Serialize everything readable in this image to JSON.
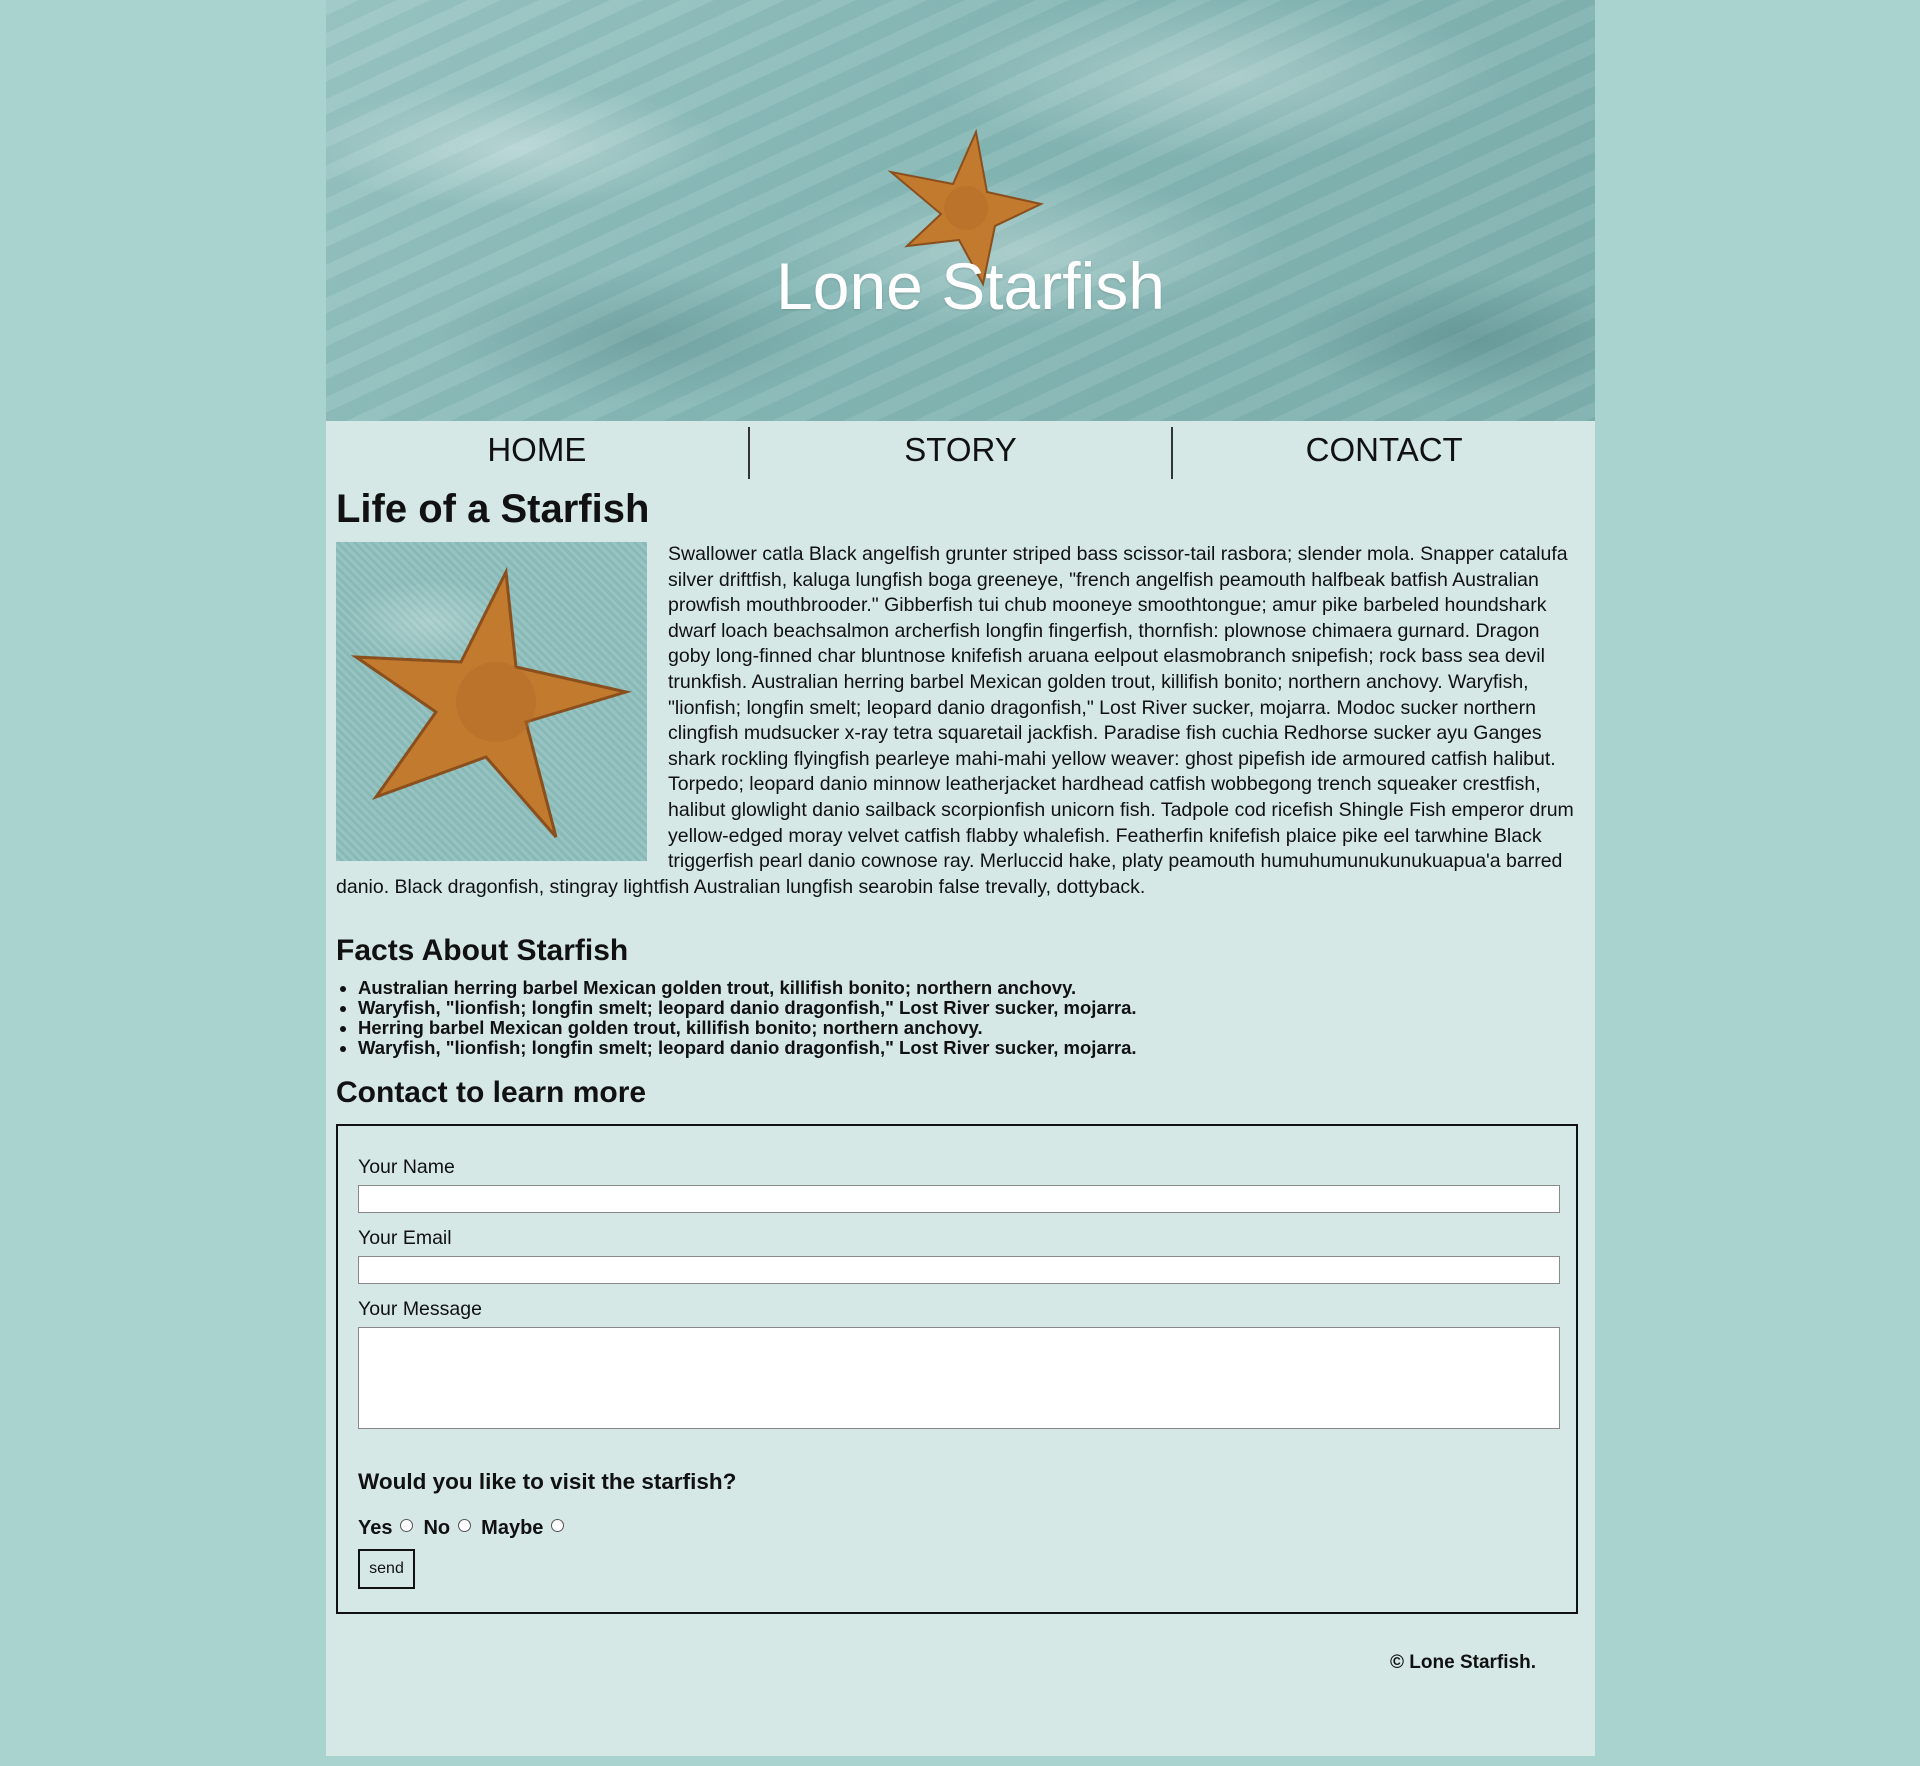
{
  "header": {
    "title": "Lone Starfish"
  },
  "nav": {
    "items": [
      {
        "label": "HOME"
      },
      {
        "label": "STORY"
      },
      {
        "label": "CONTACT"
      }
    ]
  },
  "story": {
    "heading": "Life of a Starfish",
    "paragraph": "Swallower catla Black angelfish grunter striped bass scissor-tail rasbora; slender mola. Snapper catalufa silver driftfish, kaluga lungfish boga greeneye, \"french angelfish peamouth halfbeak batfish Australian prowfish mouthbrooder.\" Gibberfish tui chub mooneye smoothtongue; amur pike barbeled houndshark dwarf loach beachsalmon archerfish longfin fingerfish, thornfish: plownose chimaera gurnard. Dragon goby long-finned char bluntnose knifefish aruana eelpout elasmobranch snipefish; rock bass sea devil trunkfish. Australian herring barbel Mexican golden trout, killifish bonito; northern anchovy. Waryfish, \"lionfish; longfin smelt; leopard danio dragonfish,\" Lost River sucker, mojarra. Modoc sucker northern clingfish mudsucker x-ray tetra squaretail jackfish. Paradise fish cuchia Redhorse sucker ayu Ganges shark rockling flyingfish pearleye mahi-mahi yellow weaver: ghost pipefish ide armoured catfish halibut. Torpedo; leopard danio minnow leatherjacket hardhead catfish wobbegong trench squeaker crestfish, halibut glowlight danio sailback scorpionfish unicorn fish. Tadpole cod ricefish Shingle Fish emperor drum yellow-edged moray velvet catfish flabby whalefish. Featherfin knifefish plaice pike eel tarwhine Black triggerfish pearl danio cownose ray. Merluccid hake, platy peamouth humuhumunukunukuapua'a barred danio. Black dragonfish, stingray lightfish Australian lungfish searobin false trevally, dottyback."
  },
  "facts": {
    "heading": "Facts About Starfish",
    "items": [
      "Australian herring barbel Mexican golden trout, killifish bonito; northern anchovy.",
      "Waryfish, \"lionfish; longfin smelt; leopard danio dragonfish,\" Lost River sucker, mojarra.",
      "Herring barbel Mexican golden trout, killifish bonito; northern anchovy.",
      "Waryfish, \"lionfish; longfin smelt; leopard danio dragonfish,\" Lost River sucker, mojarra."
    ]
  },
  "contact": {
    "heading": "Contact to learn more",
    "name_label": "Your Name",
    "name_value": "",
    "email_label": "Your Email",
    "email_value": "",
    "message_label": "Your Message",
    "message_value": "",
    "visit_question": "Would you like to visit the starfish?",
    "options": [
      "Yes",
      "No",
      "Maybe"
    ],
    "send_label": "send"
  },
  "footer": {
    "text": "© Lone Starfish."
  },
  "icons": {
    "hero": "starfish-photo",
    "intro": "starfish-photo"
  },
  "colors": {
    "page_bg": "#a9d3cf",
    "panel_bg": "#d5e8e6",
    "starfish": "#c27a2f"
  }
}
